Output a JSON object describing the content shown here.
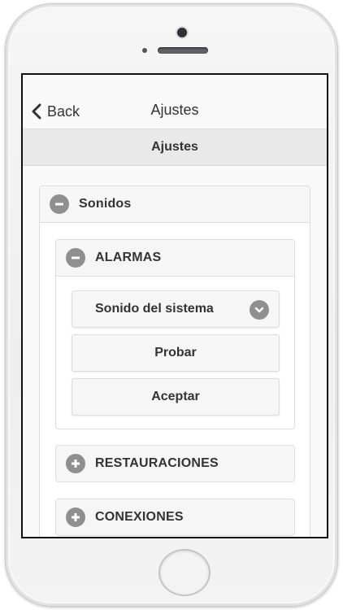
{
  "header": {
    "back_label": "Back",
    "title": "Ajustes"
  },
  "subheader": {
    "title": "Ajustes"
  },
  "sections": {
    "sonidos": {
      "label": "Sonidos",
      "state": "expanded"
    },
    "alarmas": {
      "label": "ALARMAS",
      "state": "expanded",
      "select_value": "Sonido del sistema",
      "probar_label": "Probar",
      "aceptar_label": "Aceptar"
    },
    "restauraciones": {
      "label": "RESTAURACIONES",
      "state": "collapsed"
    },
    "conexiones": {
      "label": "CONEXIONES",
      "state": "collapsed"
    }
  },
  "icons": {
    "back": "chevron-left-icon",
    "expanded": "minus-icon",
    "collapsed": "plus-icon",
    "select": "chevron-down-icon"
  },
  "colors": {
    "icon_bg": "#8f8f8f",
    "bar_bg": "#e9e9e9",
    "button_bg": "#f6f6f6",
    "text": "#333333"
  }
}
